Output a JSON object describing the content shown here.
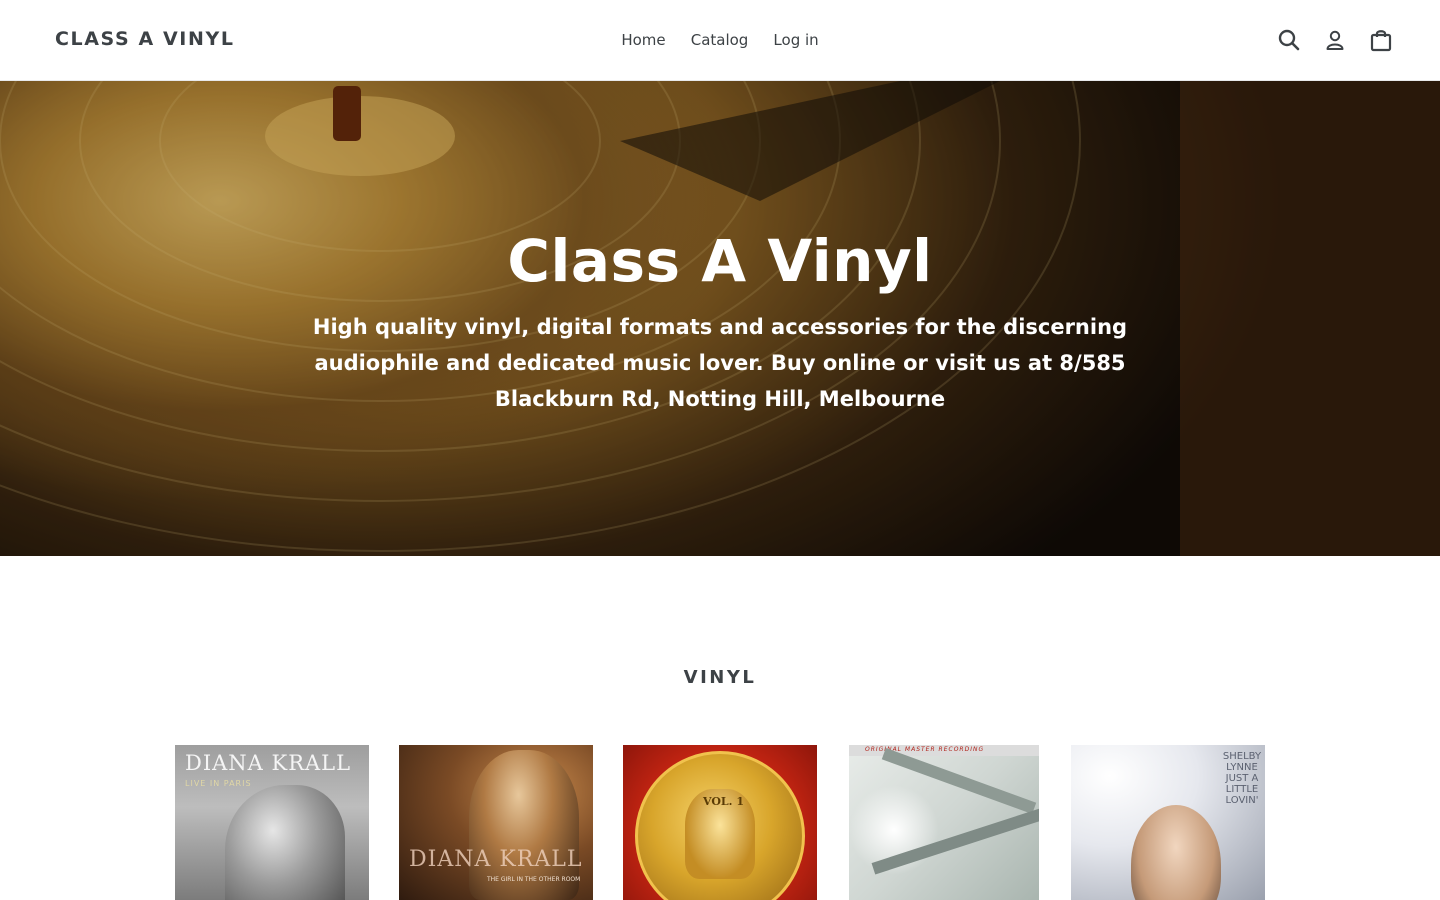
{
  "header": {
    "logo": "CLASS A VINYL",
    "nav": [
      {
        "label": "Home"
      },
      {
        "label": "Catalog"
      },
      {
        "label": "Log in"
      }
    ],
    "icons": [
      "search-icon",
      "account-icon",
      "cart-icon"
    ]
  },
  "hero": {
    "title": "Class A Vinyl",
    "subtitle": "High quality vinyl, digital formats and accessories for the discerning audiophile and dedicated music lover. Buy online or visit us at 8/585 Blackburn Rd, Notting Hill, Melbourne"
  },
  "collection": {
    "title": "VINYL",
    "products": [
      {
        "cover_line1": "DIANA KRALL",
        "cover_line2": "LIVE IN PARIS"
      },
      {
        "cover_line1": "DIANA KRALL",
        "cover_line2": "THE GIRL IN THE OTHER ROOM"
      },
      {
        "cover_line1": "VOL. 1"
      },
      {
        "cover_line1": "ORIGINAL MASTER RECORDING"
      },
      {
        "cover_line1": "SHELBY LYNNE JUST A LITTLE LOVIN'"
      }
    ]
  },
  "colors": {
    "text": "#3d4246",
    "header_border": "#e8e9eb",
    "hero_text": "#ffffff"
  }
}
